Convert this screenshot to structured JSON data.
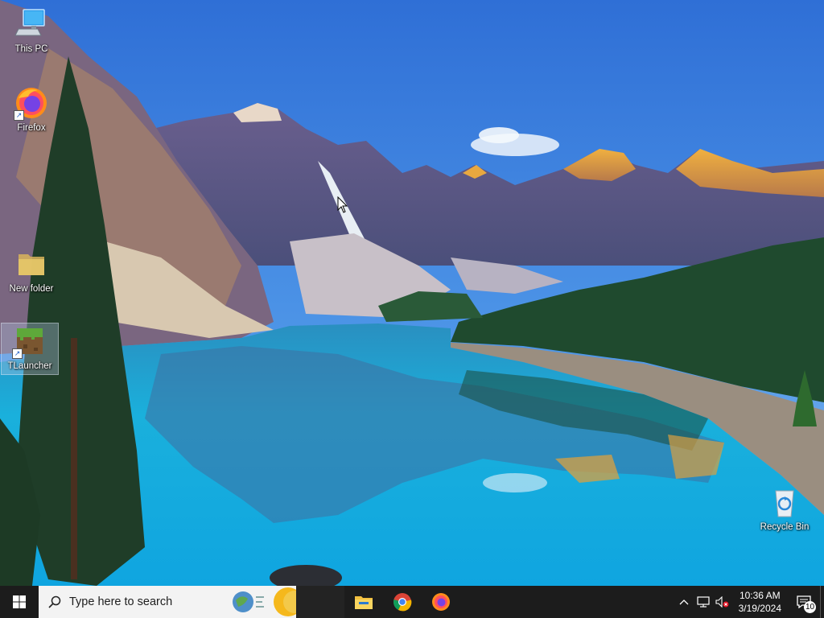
{
  "desktop": {
    "icons": [
      {
        "label": "This PC",
        "icon": "this-pc-icon"
      },
      {
        "label": "Firefox",
        "icon": "firefox-icon"
      },
      {
        "label": "New folder",
        "icon": "folder-icon"
      },
      {
        "label": "TLauncher",
        "icon": "tlauncher-icon"
      },
      {
        "label": "Recycle Bin",
        "icon": "recycle-bin-icon"
      }
    ]
  },
  "taskbar": {
    "start_icon": "windows-logo-icon",
    "search_placeholder": "Type here to search",
    "pinned": [
      {
        "name": "File Explorer",
        "icon": "file-explorer-icon"
      },
      {
        "name": "Google Chrome",
        "icon": "chrome-icon"
      },
      {
        "name": "Firefox",
        "icon": "firefox-icon"
      }
    ],
    "tray": {
      "time": "10:36 AM",
      "date": "3/19/2024",
      "notification_count": "10"
    }
  },
  "colors": {
    "taskbar": "#1c1c1c",
    "search_box": "#f3f3f3",
    "sky": "#3a86e0",
    "lake": "#1eb0dc"
  }
}
